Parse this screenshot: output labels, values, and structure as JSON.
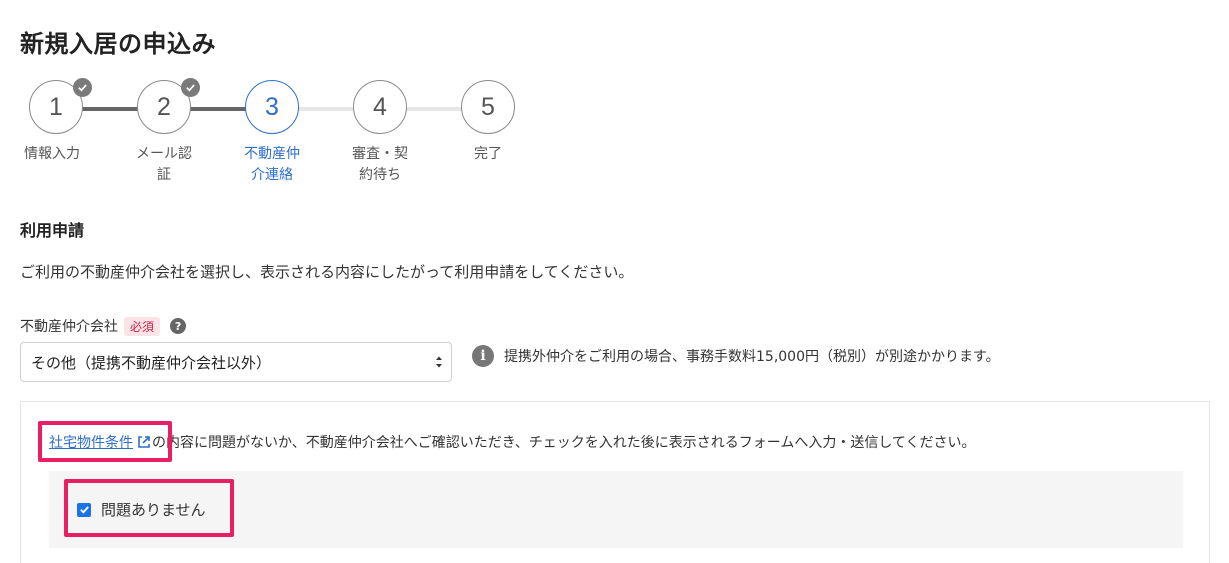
{
  "page": {
    "title": "新規入居の申込み"
  },
  "stepper": {
    "steps": [
      {
        "number": "1",
        "label": "情報入力",
        "status": "done"
      },
      {
        "number": "2",
        "label": "メール認証",
        "status": "done"
      },
      {
        "number": "3",
        "label": "不動産仲介連絡",
        "status": "active"
      },
      {
        "number": "4",
        "label": "審査・契約待ち",
        "status": "todo"
      },
      {
        "number": "5",
        "label": "完了",
        "status": "todo"
      }
    ]
  },
  "form": {
    "section_title": "利用申請",
    "description": "ご利用の不動産仲介会社を選択し、表示される内容にしたがって利用申請をしてください。",
    "broker_field": {
      "label": "不動産仲介会社",
      "required_badge": "必須",
      "selected_value": "その他（提携不動産仲介会社以外）"
    },
    "info_text": "提携外仲介をご利用の場合、事務手数料15,000円（税別）が別途かかります。"
  },
  "confirm_box": {
    "link_text": "社宅物件条件",
    "notice_text": "の内容に問題がないか、不動産仲介会社へご確認いただき、チェックを入れた後に表示されるフォームへ入力・送信してください。",
    "checkbox_label": "問題ありません",
    "checkbox_checked": true
  },
  "colors": {
    "accent": "#2e6fc9",
    "highlight": "#e91e63",
    "checkbox": "#1a73e8"
  }
}
